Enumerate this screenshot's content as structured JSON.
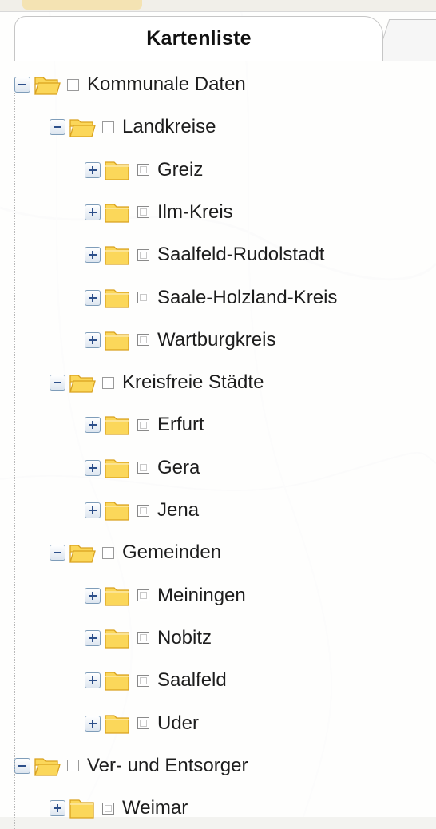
{
  "panel": {
    "tab_title": "Kartenliste"
  },
  "tree": [
    {
      "id": "kommunale-daten",
      "label": "Kommunale Daten",
      "expanded": true,
      "folder": "open",
      "level": 0
    },
    {
      "id": "landkreise",
      "label": "Landkreise",
      "expanded": true,
      "folder": "open",
      "level": 1
    },
    {
      "id": "greiz",
      "label": "Greiz",
      "expanded": false,
      "folder": "closed",
      "level": 2
    },
    {
      "id": "ilm-kreis",
      "label": "Ilm-Kreis",
      "expanded": false,
      "folder": "closed",
      "level": 2
    },
    {
      "id": "saalfeld-rudolstadt",
      "label": "Saalfeld-Rudolstadt",
      "expanded": false,
      "folder": "closed",
      "level": 2
    },
    {
      "id": "saale-holzland-kreis",
      "label": "Saale-Holzland-Kreis",
      "expanded": false,
      "folder": "closed",
      "level": 2
    },
    {
      "id": "wartburgkreis",
      "label": "Wartburgkreis",
      "expanded": false,
      "folder": "closed",
      "level": 2
    },
    {
      "id": "kreisfreie-staedte",
      "label": "Kreisfreie Städte",
      "expanded": true,
      "folder": "open",
      "level": 1
    },
    {
      "id": "erfurt",
      "label": "Erfurt",
      "expanded": false,
      "folder": "closed",
      "level": 2
    },
    {
      "id": "gera",
      "label": "Gera",
      "expanded": false,
      "folder": "closed",
      "level": 2
    },
    {
      "id": "jena",
      "label": "Jena",
      "expanded": false,
      "folder": "closed",
      "level": 2
    },
    {
      "id": "gemeinden",
      "label": "Gemeinden",
      "expanded": true,
      "folder": "open",
      "level": 1
    },
    {
      "id": "meiningen",
      "label": "Meiningen",
      "expanded": false,
      "folder": "closed",
      "level": 2
    },
    {
      "id": "nobitz",
      "label": "Nobitz",
      "expanded": false,
      "folder": "closed",
      "level": 2
    },
    {
      "id": "saalfeld",
      "label": "Saalfeld",
      "expanded": false,
      "folder": "closed",
      "level": 2
    },
    {
      "id": "uder",
      "label": "Uder",
      "expanded": false,
      "folder": "closed",
      "level": 2
    },
    {
      "id": "ver-und-entsorger",
      "label": "Ver- und Entsorger",
      "expanded": true,
      "folder": "open",
      "level": 0
    },
    {
      "id": "weimar",
      "label": "Weimar",
      "expanded": false,
      "folder": "closed",
      "level": 1
    }
  ],
  "colors": {
    "folder_fill": "#fbd75a",
    "folder_stroke": "#d9a21f",
    "expander_sign": "#2c4f8a"
  }
}
